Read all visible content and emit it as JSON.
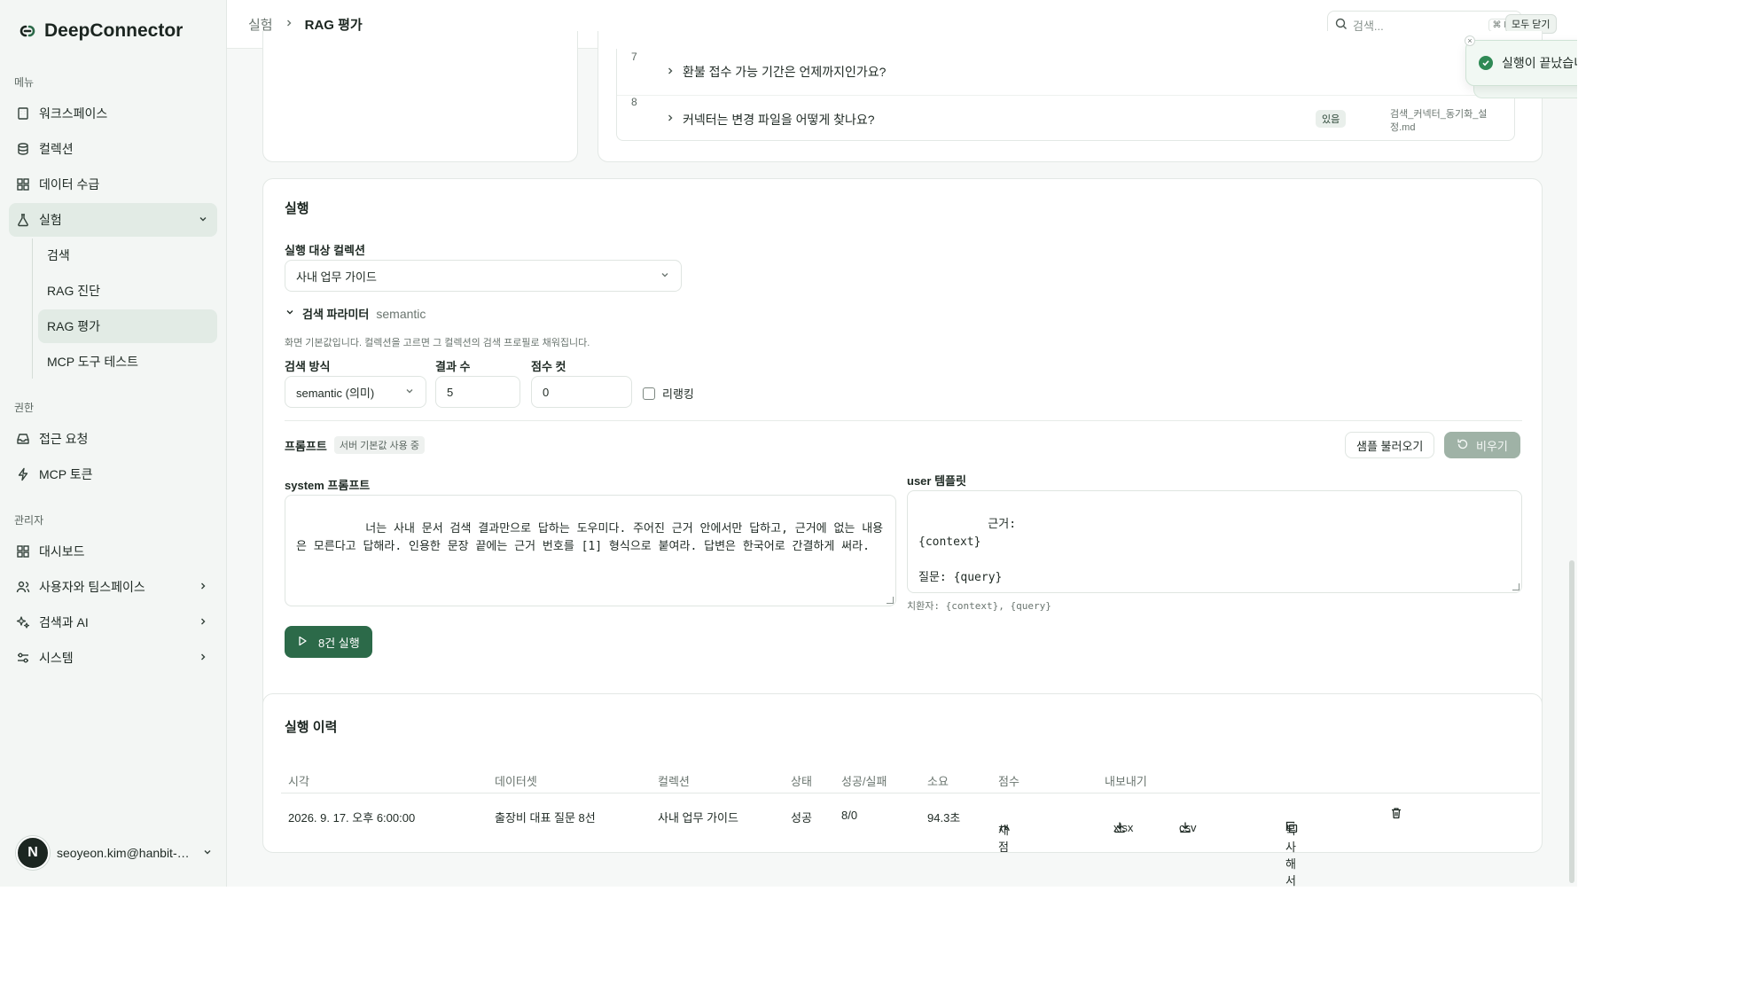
{
  "brand": {
    "name": "DeepConnector"
  },
  "sidebar": {
    "menu_label": "메뉴",
    "menu_items": [
      {
        "label": "워크스페이스",
        "icon": "building-icon"
      },
      {
        "label": "컬렉션",
        "icon": "database-icon"
      },
      {
        "label": "데이터 수급",
        "icon": "grid-icon"
      },
      {
        "label": "실험",
        "icon": "flask-icon"
      }
    ],
    "experiment_sub": [
      "검색",
      "RAG 진단",
      "RAG 평가",
      "MCP 도구 테스트"
    ],
    "permission_label": "권한",
    "permission_items": [
      {
        "label": "접근 요청",
        "icon": "inbox-icon"
      },
      {
        "label": "MCP 토큰",
        "icon": "bolt-icon"
      }
    ],
    "admin_label": "관리자",
    "admin_items": [
      {
        "label": "대시보드",
        "icon": "grid-icon"
      },
      {
        "label": "사용자와 팀스페이스",
        "icon": "users-icon"
      },
      {
        "label": "검색과 AI",
        "icon": "sparkles-icon"
      },
      {
        "label": "시스템",
        "icon": "sliders-icon"
      }
    ],
    "user": {
      "avatar": "N",
      "email": "seoyeon.kim@hanbit-de..."
    }
  },
  "topbar": {
    "crumb_parent": "실험",
    "crumb_current": "RAG 평가",
    "search_placeholder": "검색...",
    "search_kbd": "⌘ K",
    "close_all": "모두 닫기"
  },
  "toast": {
    "message": "실행이 끝났습니다.",
    "close": "×"
  },
  "questions": [
    {
      "num": "7",
      "text": "환불 접수 가능 기간은 언제까지인가요?",
      "badge": "",
      "source": ""
    },
    {
      "num": "8",
      "text": "커넥터는 변경 파일을 어떻게 찾나요?",
      "badge": "있음",
      "source": "검색_커넥터_동기화_설정.md"
    }
  ],
  "run": {
    "title": "실행",
    "collection_label": "실행 대상 컬렉션",
    "collection_value": "사내 업무 가이드",
    "params_label": "검색 파라미터",
    "params_mode": "semantic",
    "params_hint": "화면 기본값입니다. 컬렉션을 고르면 그 컬렉션의 검색 프로필로 채워집니다.",
    "method_label": "검색 방식",
    "method_value": "semantic (의미)",
    "count_label": "결과 수",
    "count_value": "5",
    "cut_label": "점수 컷",
    "cut_value": "0",
    "rerank_label": "리랭킹",
    "prompt_label": "프롬프트",
    "prompt_badge": "서버 기본값 사용 중",
    "sample_button": "샘플 불러오기",
    "clear_button": "비우기",
    "system_label": "system 프롬프트",
    "system_value": "너는 사내 문서 검색 결과만으로 답하는 도우미다. 주어진 근거 안에서만 답하고, 근거에 없는 내용은 모른다고 답해라. 인용한 문장 끝에는 근거 번호를 [1] 형식으로 붙여라. 답변은 한국어로 간결하게 써라.",
    "user_label": "user 템플릿",
    "user_value": "근거:\n{context}\n\n질문: {query}",
    "placeholder_hint": "치환자: {context}, {query}",
    "run_button": "8건 실행"
  },
  "history": {
    "title": "실행 이력",
    "columns": [
      "시각",
      "데이터셋",
      "컬렉션",
      "상태",
      "성공/실패",
      "소요",
      "점수",
      "내보내기"
    ],
    "rows": [
      {
        "time": "2026. 9. 17. 오후 6:00:00",
        "dataset": "출장비 대표 질문 8선",
        "collection": "사내 업무 가이드",
        "status": "성공",
        "success_fail": "8/0",
        "duration": "94.3초",
        "score": "채점",
        "xlsx": "xlsx",
        "csv": "csv",
        "copy_run": "복사해서 실행"
      }
    ]
  },
  "colors": {
    "accent": "#2c6a49",
    "sidebar_bg": "#f3f6f4",
    "active_bg": "#e2ebe5"
  }
}
